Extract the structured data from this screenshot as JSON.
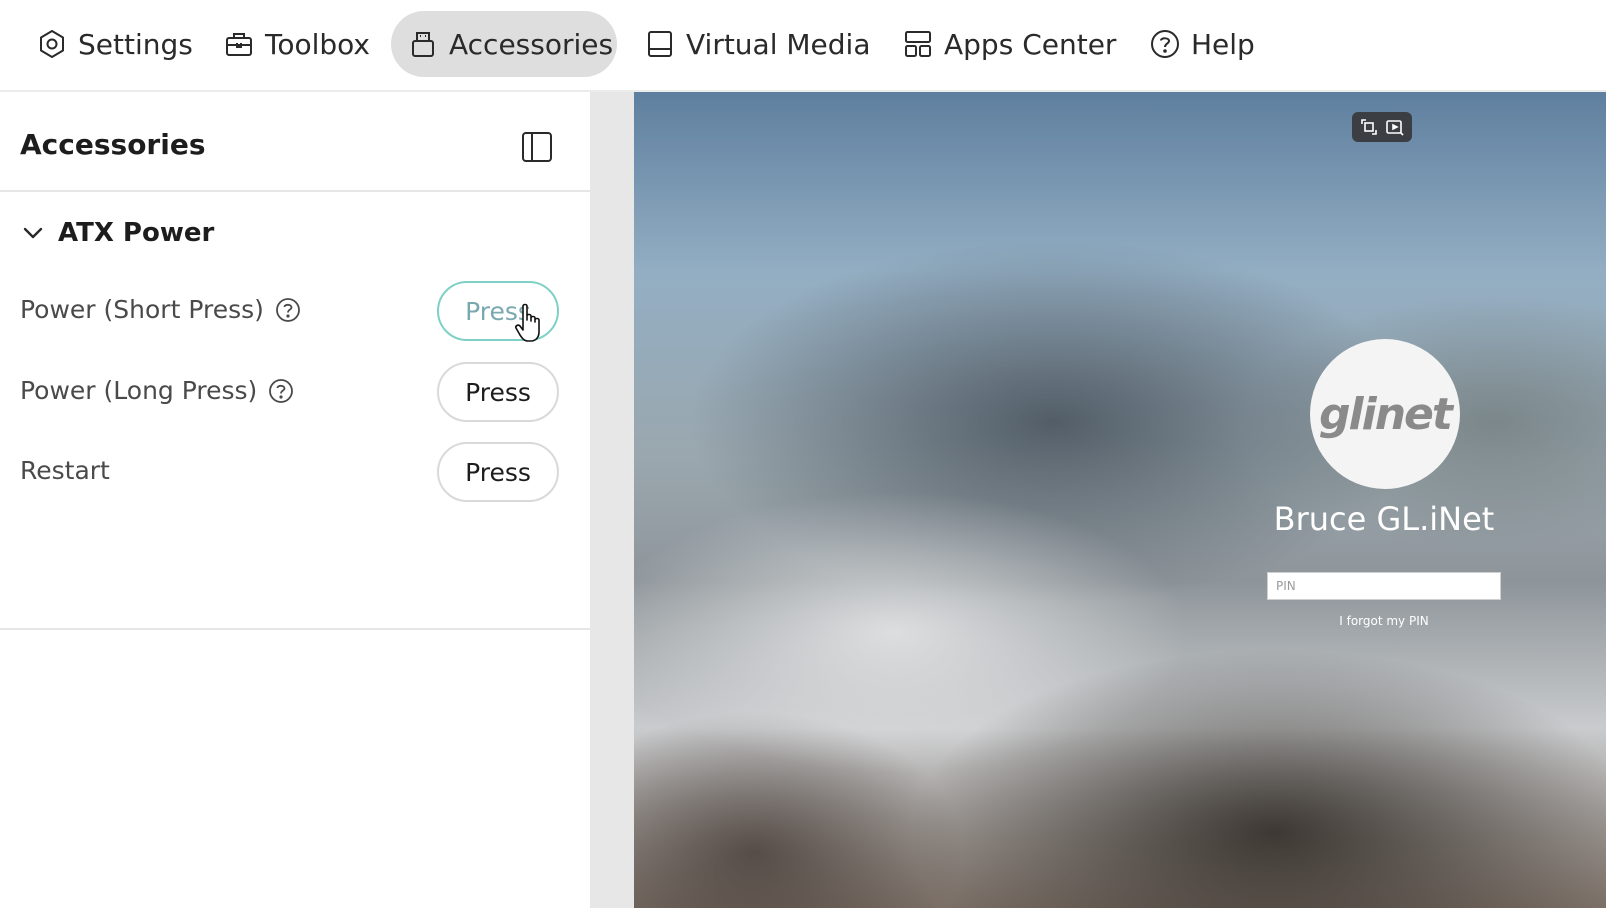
{
  "nav": {
    "items": [
      {
        "label": "Settings",
        "icon": "settings-icon",
        "active": false
      },
      {
        "label": "Toolbox",
        "icon": "toolbox-icon",
        "active": false
      },
      {
        "label": "Accessories",
        "icon": "accessories-icon",
        "active": true
      },
      {
        "label": "Virtual Media",
        "icon": "virtual-media-icon",
        "active": false
      },
      {
        "label": "Apps Center",
        "icon": "apps-center-icon",
        "active": false
      },
      {
        "label": "Help",
        "icon": "help-icon",
        "active": false
      }
    ]
  },
  "panel": {
    "title": "Accessories",
    "toggle_icon": "panel-toggle-icon",
    "section": {
      "title": "ATX Power",
      "expanded": true,
      "rows": [
        {
          "label": "Power (Short Press)",
          "has_help": true,
          "button": "Press",
          "hovered": true
        },
        {
          "label": "Power (Long Press)",
          "has_help": true,
          "button": "Press",
          "hovered": false
        },
        {
          "label": "Restart",
          "has_help": false,
          "button": "Press",
          "hovered": false
        }
      ]
    }
  },
  "screen": {
    "logo_text": "glinet",
    "user_name": "Bruce GL.iNet",
    "pin_placeholder": "PIN",
    "forgot_link": "I forgot my PIN",
    "toolbar_icons": [
      "exit-fullscreen-icon",
      "screen-capture-icon"
    ]
  },
  "colors": {
    "nav_active_bg": "#dedede",
    "button_hover_border": "#7fd0c6",
    "panel_divider": "#e6e6e6"
  }
}
